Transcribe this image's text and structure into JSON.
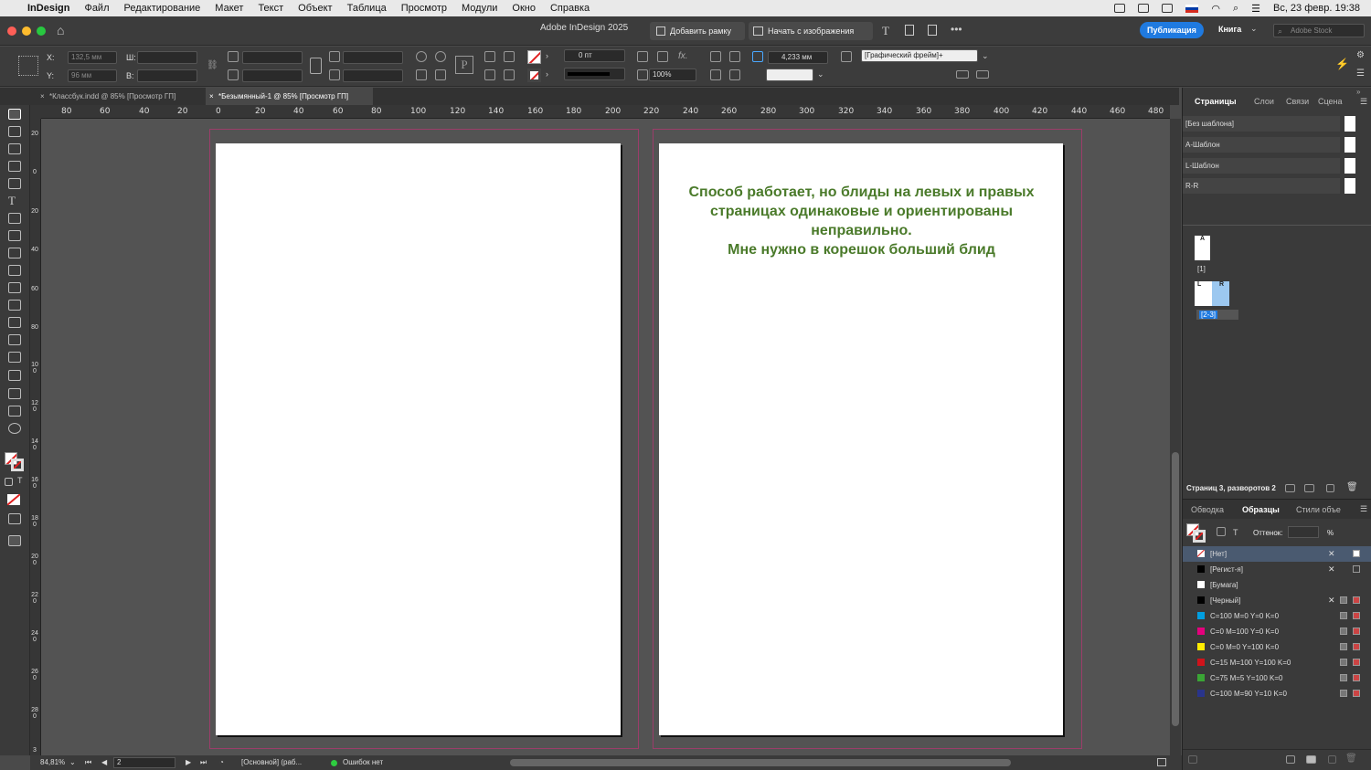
{
  "menubar": {
    "app": "InDesign",
    "items": [
      "Файл",
      "Редактирование",
      "Макет",
      "Текст",
      "Объект",
      "Таблица",
      "Просмотр",
      "Модули",
      "Окно",
      "Справка"
    ],
    "clock": "Вс, 23 февр.  19:38"
  },
  "titlebar": {
    "title": "Adobe InDesign 2025",
    "add_frame": "Добавить рамку",
    "start_image": "Начать с изображения",
    "publish": "Публикация",
    "workspace": "Книга",
    "stock_placeholder": "Adobe Stock"
  },
  "control": {
    "x_label": "X:",
    "y_label": "Y:",
    "x_value": "132,5 мм",
    "y_value": "96 мм",
    "w_label": "Ш:",
    "h_label": "В:",
    "stroke_weight": "0 пт",
    "zoom_pct": "100%",
    "dim_value": "4,233 мм",
    "frame_style": "[Графический фрейм]+"
  },
  "tabs": [
    {
      "label": "*Классбук.indd @ 85% [Просмотр ГП]",
      "active": false
    },
    {
      "label": "*Безымянный-1 @ 85% [Просмотр ГП]",
      "active": true
    }
  ],
  "ruler": {
    "labels": [
      "80",
      "60",
      "40",
      "20",
      "0",
      "20",
      "40",
      "60",
      "80",
      "100",
      "120",
      "140",
      "160",
      "180",
      "200",
      "220",
      "240",
      "260",
      "280",
      "300",
      "320",
      "340",
      "360",
      "380",
      "400",
      "420",
      "440",
      "460",
      "480"
    ],
    "v_labels": [
      "20",
      "0",
      "20",
      "40",
      "60",
      "80",
      "100",
      "120",
      "140",
      "160",
      "180",
      "200",
      "220",
      "240",
      "260",
      "280",
      "3"
    ]
  },
  "document": {
    "note_lines": [
      "Способ работает, но блиды на левых и правых",
      "страницах одинаковые и ориентированы",
      "неправильно.",
      "Мне нужно в корешок больший блид"
    ]
  },
  "status": {
    "zoom": "84,81%",
    "page": "2",
    "master": "[Основной] (раб...",
    "errors": "Ошибок нет"
  },
  "panel": {
    "tabs": [
      "Страницы",
      "Слои",
      "Связи",
      "Сцена"
    ],
    "masters": [
      "[Без шаблона]",
      "А-Шаблон",
      "L-Шаблон",
      "R-R"
    ],
    "page1_master": "A",
    "page1_label": "[1]",
    "spread_left": "L",
    "spread_right": "R",
    "spread_label": "[2-3]",
    "footer": "Страниц 3, разворотов 2",
    "swatch_tabs": [
      "Обводка",
      "Образцы",
      "Стили объе"
    ],
    "tint_label": "Оттенок:",
    "tint_unit": "%",
    "swatches": [
      {
        "name": "[Нет]",
        "color": "none"
      },
      {
        "name": "[Регист-я]",
        "color": "#000000"
      },
      {
        "name": "[Бумага]",
        "color": "#ffffff"
      },
      {
        "name": "[Черный]",
        "color": "#000000"
      },
      {
        "name": "C=100 M=0 Y=0 K=0",
        "color": "#009ee0"
      },
      {
        "name": "C=0 M=100 Y=0 K=0",
        "color": "#e5007d"
      },
      {
        "name": "C=0 M=0 Y=100 K=0",
        "color": "#ffed00"
      },
      {
        "name": "C=15 M=100 Y=100 K=0",
        "color": "#d0131b"
      },
      {
        "name": "C=75 M=5 Y=100 K=0",
        "color": "#3aa535"
      },
      {
        "name": "C=100 M=90 Y=10 K=0",
        "color": "#29348b"
      }
    ]
  },
  "colors": {
    "publish_button": "#1f7ae0",
    "note_text": "#4a7a2a",
    "bleed_guide": "#9b3d6a",
    "selected_row": "#4a5a70"
  }
}
